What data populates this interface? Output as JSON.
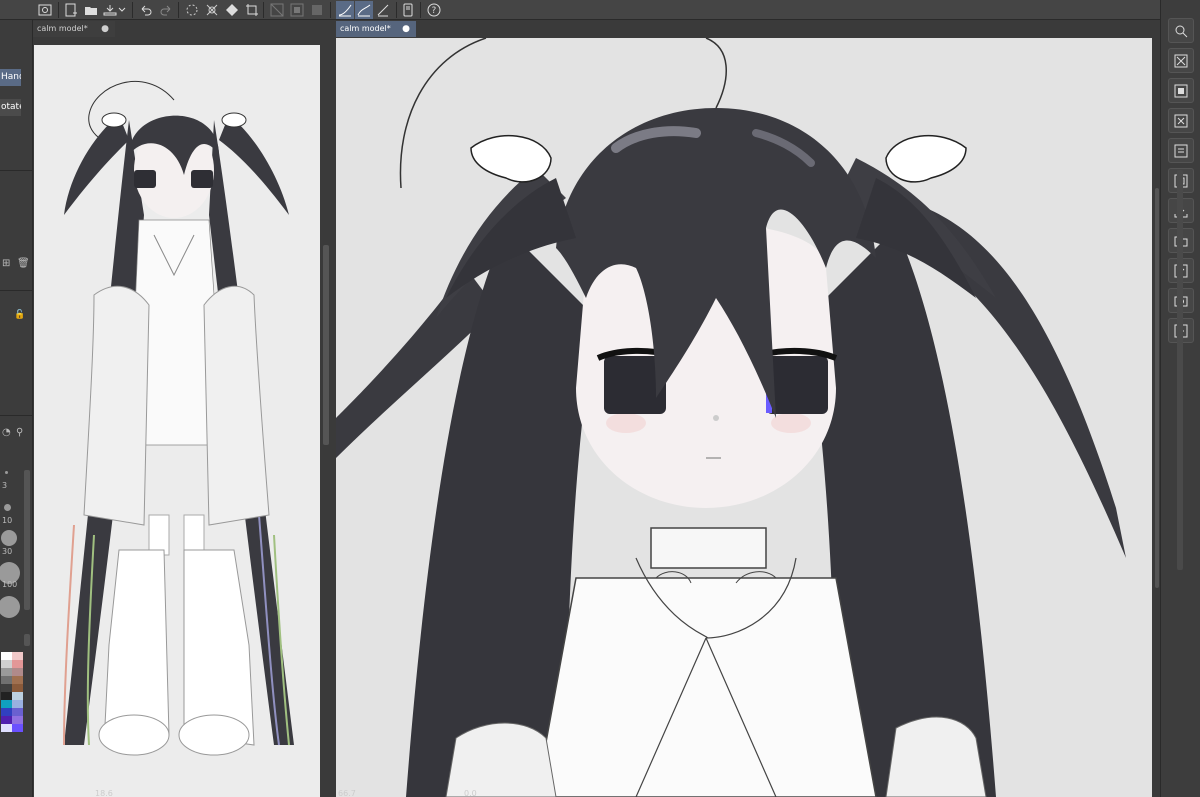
{
  "toolbar": {
    "icons": [
      "app-icon",
      "new-icon",
      "open-icon",
      "save-icon",
      "export-icon",
      "chevron-down-icon",
      "undo-icon",
      "redo-icon",
      "loading-icon",
      "transform-icon",
      "fill-icon",
      "crop-icon",
      "snap-off-icon",
      "snap-icon",
      "ruler-icon",
      "stabilizer-curve-icon",
      "stabilizer-pen-icon",
      "pen-pressure-icon",
      "device-icon",
      "help-icon"
    ]
  },
  "left_strip": {
    "tool_hand": "Hand",
    "tool_rotate": "otate",
    "brush_sizes": [
      "3",
      "10",
      "30",
      "100"
    ]
  },
  "navigator": {
    "tab_label": "calm model*",
    "tab_dot": "●",
    "zoom_readout": "18.6"
  },
  "main": {
    "tab_label": "calm model*",
    "tab_dot": "●",
    "zoom_readout": "66.7",
    "angle_readout": "0.0"
  },
  "nav_readout_angle": "0.0",
  "right_strip": {
    "buttons": [
      "search-icon",
      "layer-clear-icon",
      "layer-copy-icon",
      "layer-delete-icon",
      "layer-merge-icon",
      "layer-settings-icon",
      "import-icon",
      "folder-icon",
      "checklist-icon",
      "camera-icon",
      "accessibility-icon"
    ]
  },
  "colors": {
    "accent": "#5a6b86",
    "panel": "#3a3a3a",
    "canvas_bg": "#e3e3e3",
    "hair": "#3a3a40"
  }
}
